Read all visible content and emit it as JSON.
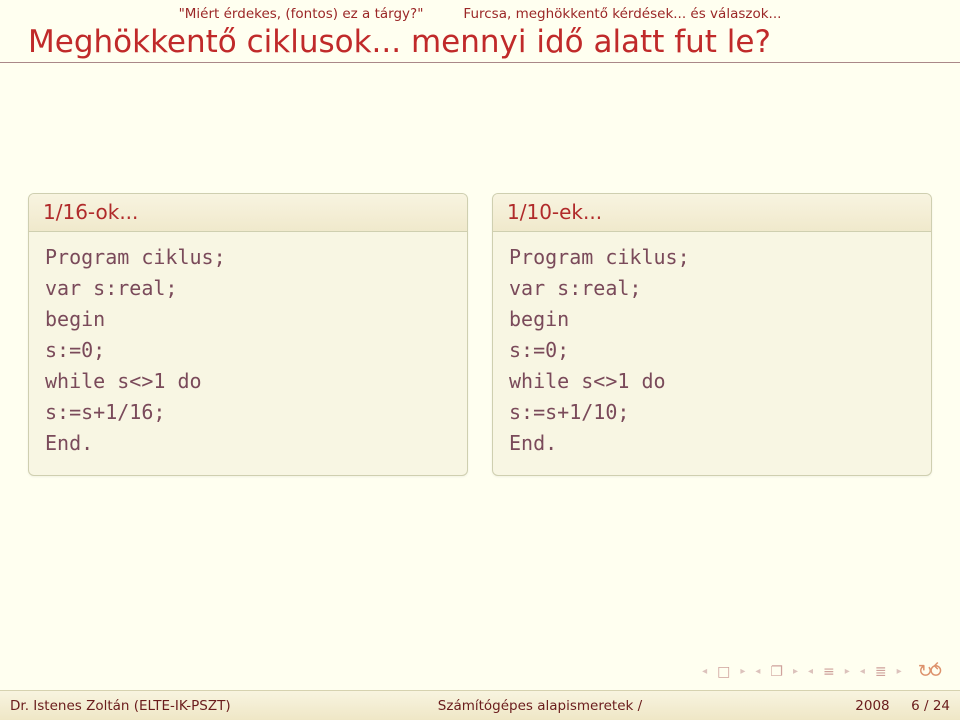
{
  "nav": {
    "crumb1": "\"Miért érdekes, (fontos) ez a tárgy?\"",
    "crumb2": "Furcsa, meghökkentő kérdések... és válaszok..."
  },
  "title": "Meghökkentő ciklusok... mennyi idő alatt fut le?",
  "blocks": {
    "left": {
      "header": "1/16-ok...",
      "lines": [
        "Program ciklus;",
        "var s:real;",
        "begin",
        "s:=0;",
        "while s<>1 do",
        "s:=s+1/16;",
        "End."
      ]
    },
    "right": {
      "header": "1/10-ek...",
      "lines": [
        "Program ciklus;",
        "var s:real;",
        "begin",
        "s:=0;",
        "while s<>1 do",
        "s:=s+1/10;",
        "End."
      ]
    }
  },
  "footer": {
    "author": "Dr. Istenes Zoltán (ELTE-IK-PSZT)",
    "course": "Számítógépes alapismeretek /",
    "year": "2008",
    "page": "6 / 24"
  },
  "navicons": {
    "back": "◄",
    "sep": "▸",
    "dup": "❐",
    "up": "◄",
    "down": "▸",
    "eq": "≡",
    "play": "▸",
    "refresh": "↻∩◯"
  }
}
